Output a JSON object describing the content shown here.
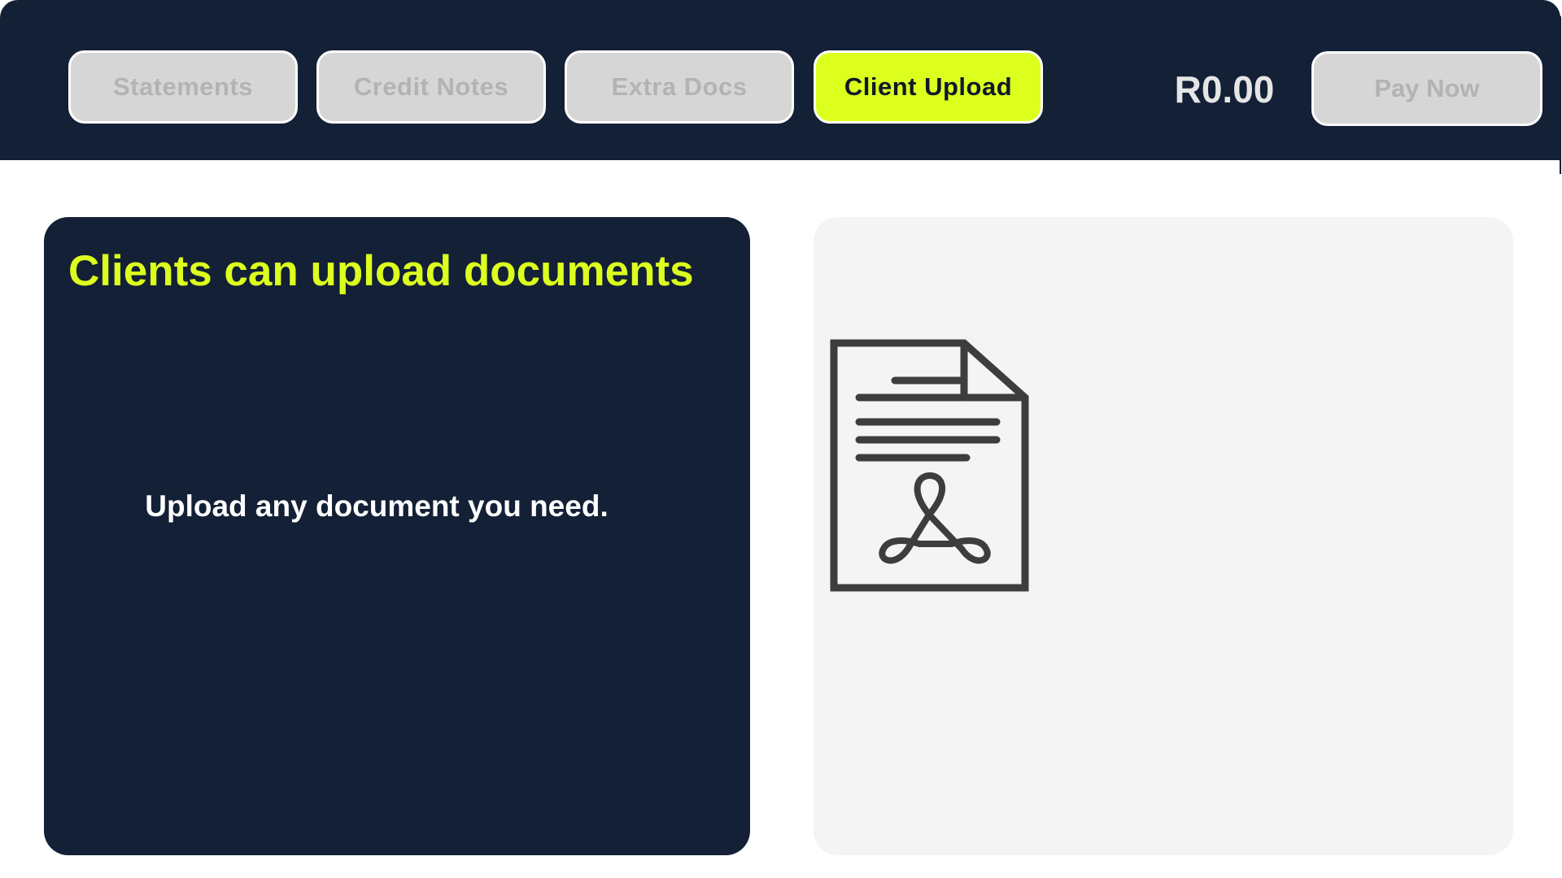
{
  "nav": {
    "tabs": [
      {
        "label": "Statements",
        "active": false
      },
      {
        "label": "Credit Notes",
        "active": false
      },
      {
        "label": "Extra Docs",
        "active": false
      },
      {
        "label": "Client Upload",
        "active": true
      }
    ],
    "balance": "R0.00",
    "pay_label": "Pay Now"
  },
  "info": {
    "title": "Clients can upload documents",
    "body": "Upload any document you need."
  },
  "preview": {
    "icon": "pdf-document-icon"
  },
  "colors": {
    "navy": "#132036",
    "accent": "#dcff1e",
    "button_inactive": "#d6d6d6",
    "panel_bg": "#f4f4f4",
    "icon_stroke": "#3d3d3d"
  }
}
